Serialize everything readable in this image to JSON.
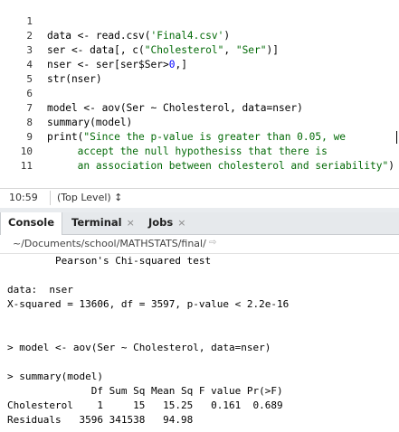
{
  "editor": {
    "lines": [
      {
        "num": "1"
      },
      {
        "num": "2"
      },
      {
        "num": "3"
      },
      {
        "num": "4"
      },
      {
        "num": "5"
      },
      {
        "num": "6"
      },
      {
        "num": "7"
      },
      {
        "num": "8"
      },
      {
        "num": "9"
      },
      {
        "num": "10"
      },
      {
        "num": "11"
      }
    ],
    "code": {
      "l1_a": "data <- read.csv(",
      "l1_s": "'Final4.csv'",
      "l1_b": ")",
      "l2_a": "ser <- data[, c(",
      "l2_s1": "\"Cholesterol\"",
      "l2_c": ", ",
      "l2_s2": "\"Ser\"",
      "l2_b": ")]",
      "l3_a": "nser <- ser[ser$Ser>",
      "l3_n": "0",
      "l3_b": ",]",
      "l4": "str(nser)",
      "l5": "",
      "l6": "model <- aov(Ser ~ Cholesterol, data=nser)",
      "l7": "summary(model)",
      "l8_a": "print(",
      "l8_s": "\"Since the p-value is greater than 0.05, we",
      "l9_s": "     accept the null hypothesiss that there is",
      "l10_s": "     an association between cholesterol and seriability\"",
      "l10_b": ")",
      "l11": ""
    }
  },
  "status": {
    "position": "10:59",
    "scope": "(Top Level) ↕"
  },
  "tabs": [
    {
      "label": "Console",
      "close": ""
    },
    {
      "label": "Terminal",
      "close": "×"
    },
    {
      "label": "Jobs",
      "close": "×"
    }
  ],
  "path": {
    "text": "~/Documents/school/MATHSTATS/final/",
    "arrow_icon": "⇨"
  },
  "console": {
    "lines": [
      "        Pearson's Chi-squared test",
      "",
      "data:  nser",
      "X-squared = 13606, df = 3597, p-value < 2.2e-16",
      "",
      "",
      "> model <- aov(Ser ~ Cholesterol, data=nser)",
      "",
      "> summary(model)",
      "              Df Sum Sq Mean Sq F value Pr(>F)",
      "Cholesterol    1     15   15.25   0.161  0.689",
      "Residuals   3596 341538   94.98"
    ]
  }
}
